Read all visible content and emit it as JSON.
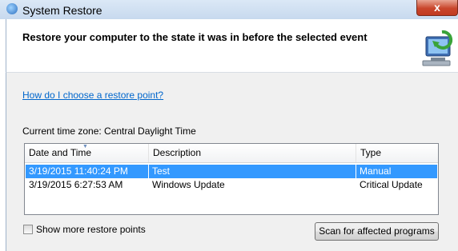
{
  "window": {
    "title": "System Restore",
    "close_glyph": "x"
  },
  "header": {
    "heading": "Restore your computer to the state it was in before the selected event"
  },
  "links": {
    "help": "How do I choose a restore point?"
  },
  "timezone": {
    "label": "Current time zone: Central Daylight Time"
  },
  "table": {
    "columns": [
      "Date and Time",
      "Description",
      "Type"
    ],
    "sorted_column": "Date and Time",
    "rows": [
      {
        "date": "3/19/2015 11:40:24 PM",
        "description": "Test",
        "type": "Manual",
        "selected": true
      },
      {
        "date": "3/19/2015 6:27:53 AM",
        "description": "Windows Update",
        "type": "Critical Update",
        "selected": false
      }
    ]
  },
  "options": {
    "show_more_label": "Show more restore points",
    "show_more_checked": false
  },
  "buttons": {
    "scan_label": "Scan for affected programs"
  },
  "colors": {
    "selection": "#3399ff",
    "link": "#0066cc",
    "close_button": "#c9462c"
  },
  "icons": {
    "title_icon": "system-restore-icon",
    "header_art": "computer-restore-arrow-icon"
  }
}
